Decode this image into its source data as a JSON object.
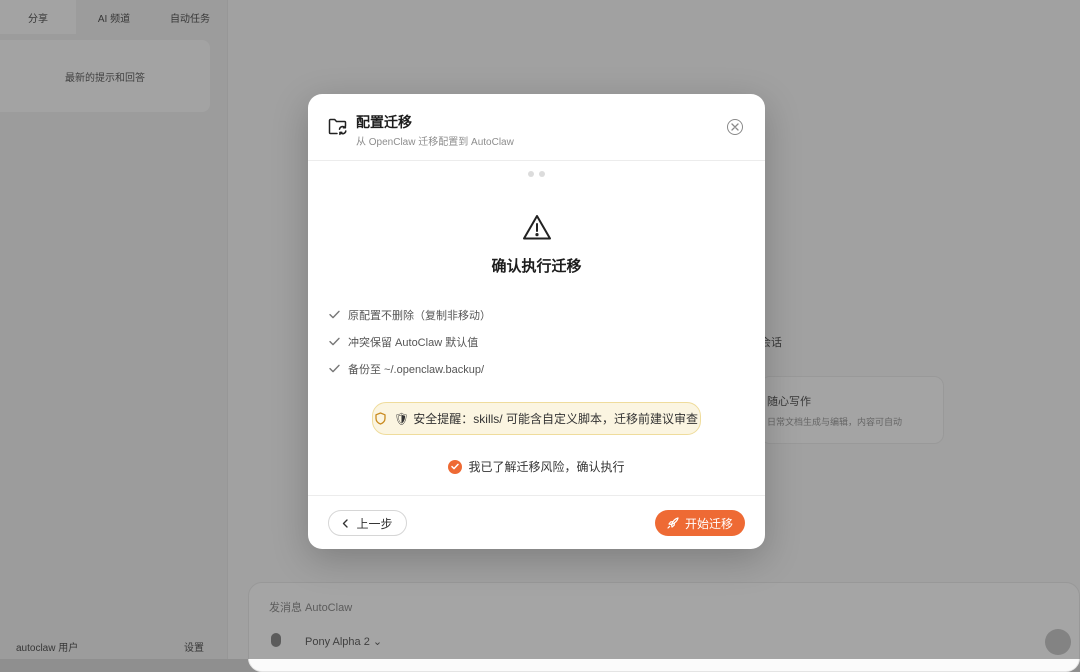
{
  "background": {
    "sidebar_tabs": [
      "分享",
      "AI 频道",
      "自动任务"
    ],
    "session_item": "最新的提示和回答",
    "user_label": "autoclaw 用户",
    "user_right": "设置",
    "side_text": "会话",
    "card_title": "随心写作",
    "card_subtitle": "日常文档生成与编辑，内容可自动",
    "composer_placeholder": "发消息 AutoClaw",
    "model_label": "Pony Alpha 2 ⌄"
  },
  "modal": {
    "title": "配置迁移",
    "subtitle": "从 OpenClaw 迁移配置到 AutoClaw",
    "step_count": 2,
    "confirm_title": "确认执行迁移",
    "checklist": [
      "原配置不删除（复制非移动）",
      "冲突保留 AutoClaw 默认值",
      "备份至 ~/.openclaw.backup/"
    ],
    "safety_emoji": "🛡",
    "safety_note": "安全提醒：skills/ 可能含自定义脚本，迁移前建议审查",
    "acknowledge_label": "我已了解迁移风险，确认执行",
    "acknowledged": true,
    "prev_label": "上一步",
    "start_label": "开始迁移"
  },
  "colors": {
    "accent": "#ee6a34",
    "warning_bg": "#fbf5e1",
    "warning_border": "#efdc9c"
  },
  "icons": [
    "folder-sync-icon",
    "close-icon",
    "warning-icon",
    "check-icon",
    "shield-icon",
    "chevron-left-icon",
    "rocket-icon"
  ]
}
